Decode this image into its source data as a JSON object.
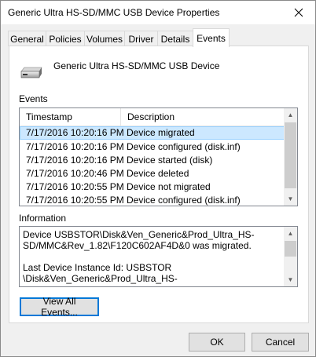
{
  "window": {
    "title": "Generic Ultra HS-SD/MMC USB Device Properties"
  },
  "tabs": [
    {
      "label": "General"
    },
    {
      "label": "Policies"
    },
    {
      "label": "Volumes"
    },
    {
      "label": "Driver"
    },
    {
      "label": "Details"
    },
    {
      "label": "Events",
      "active": true
    }
  ],
  "device": {
    "name": "Generic Ultra HS-SD/MMC USB Device",
    "icon": "drive-icon"
  },
  "events": {
    "label": "Events",
    "columns": [
      "Timestamp",
      "Description"
    ],
    "rows": [
      {
        "timestamp": "7/17/2016 10:20:16 PM",
        "description": "Device migrated",
        "selected": true
      },
      {
        "timestamp": "7/17/2016 10:20:16 PM",
        "description": "Device configured (disk.inf)"
      },
      {
        "timestamp": "7/17/2016 10:20:16 PM",
        "description": "Device started (disk)"
      },
      {
        "timestamp": "7/17/2016 10:20:46 PM",
        "description": "Device deleted"
      },
      {
        "timestamp": "7/17/2016 10:20:55 PM",
        "description": "Device not migrated"
      },
      {
        "timestamp": "7/17/2016 10:20:55 PM",
        "description": "Device configured (disk.inf)"
      }
    ]
  },
  "information": {
    "label": "Information",
    "text": "Device USBSTOR\\Disk&Ven_Generic&Prod_Ultra_HS-\nSD/MMC&Rev_1.82\\F120C602AF4D&0 was migrated.\n\nLast Device Instance Id: USBSTOR\n\\Disk&Ven_Generic&Prod_Ultra_HS-"
  },
  "buttons": {
    "view_all": "View All Events...",
    "ok": "OK",
    "cancel": "Cancel"
  },
  "colors": {
    "selection": "#cce8ff",
    "focus": "#0078d7"
  }
}
